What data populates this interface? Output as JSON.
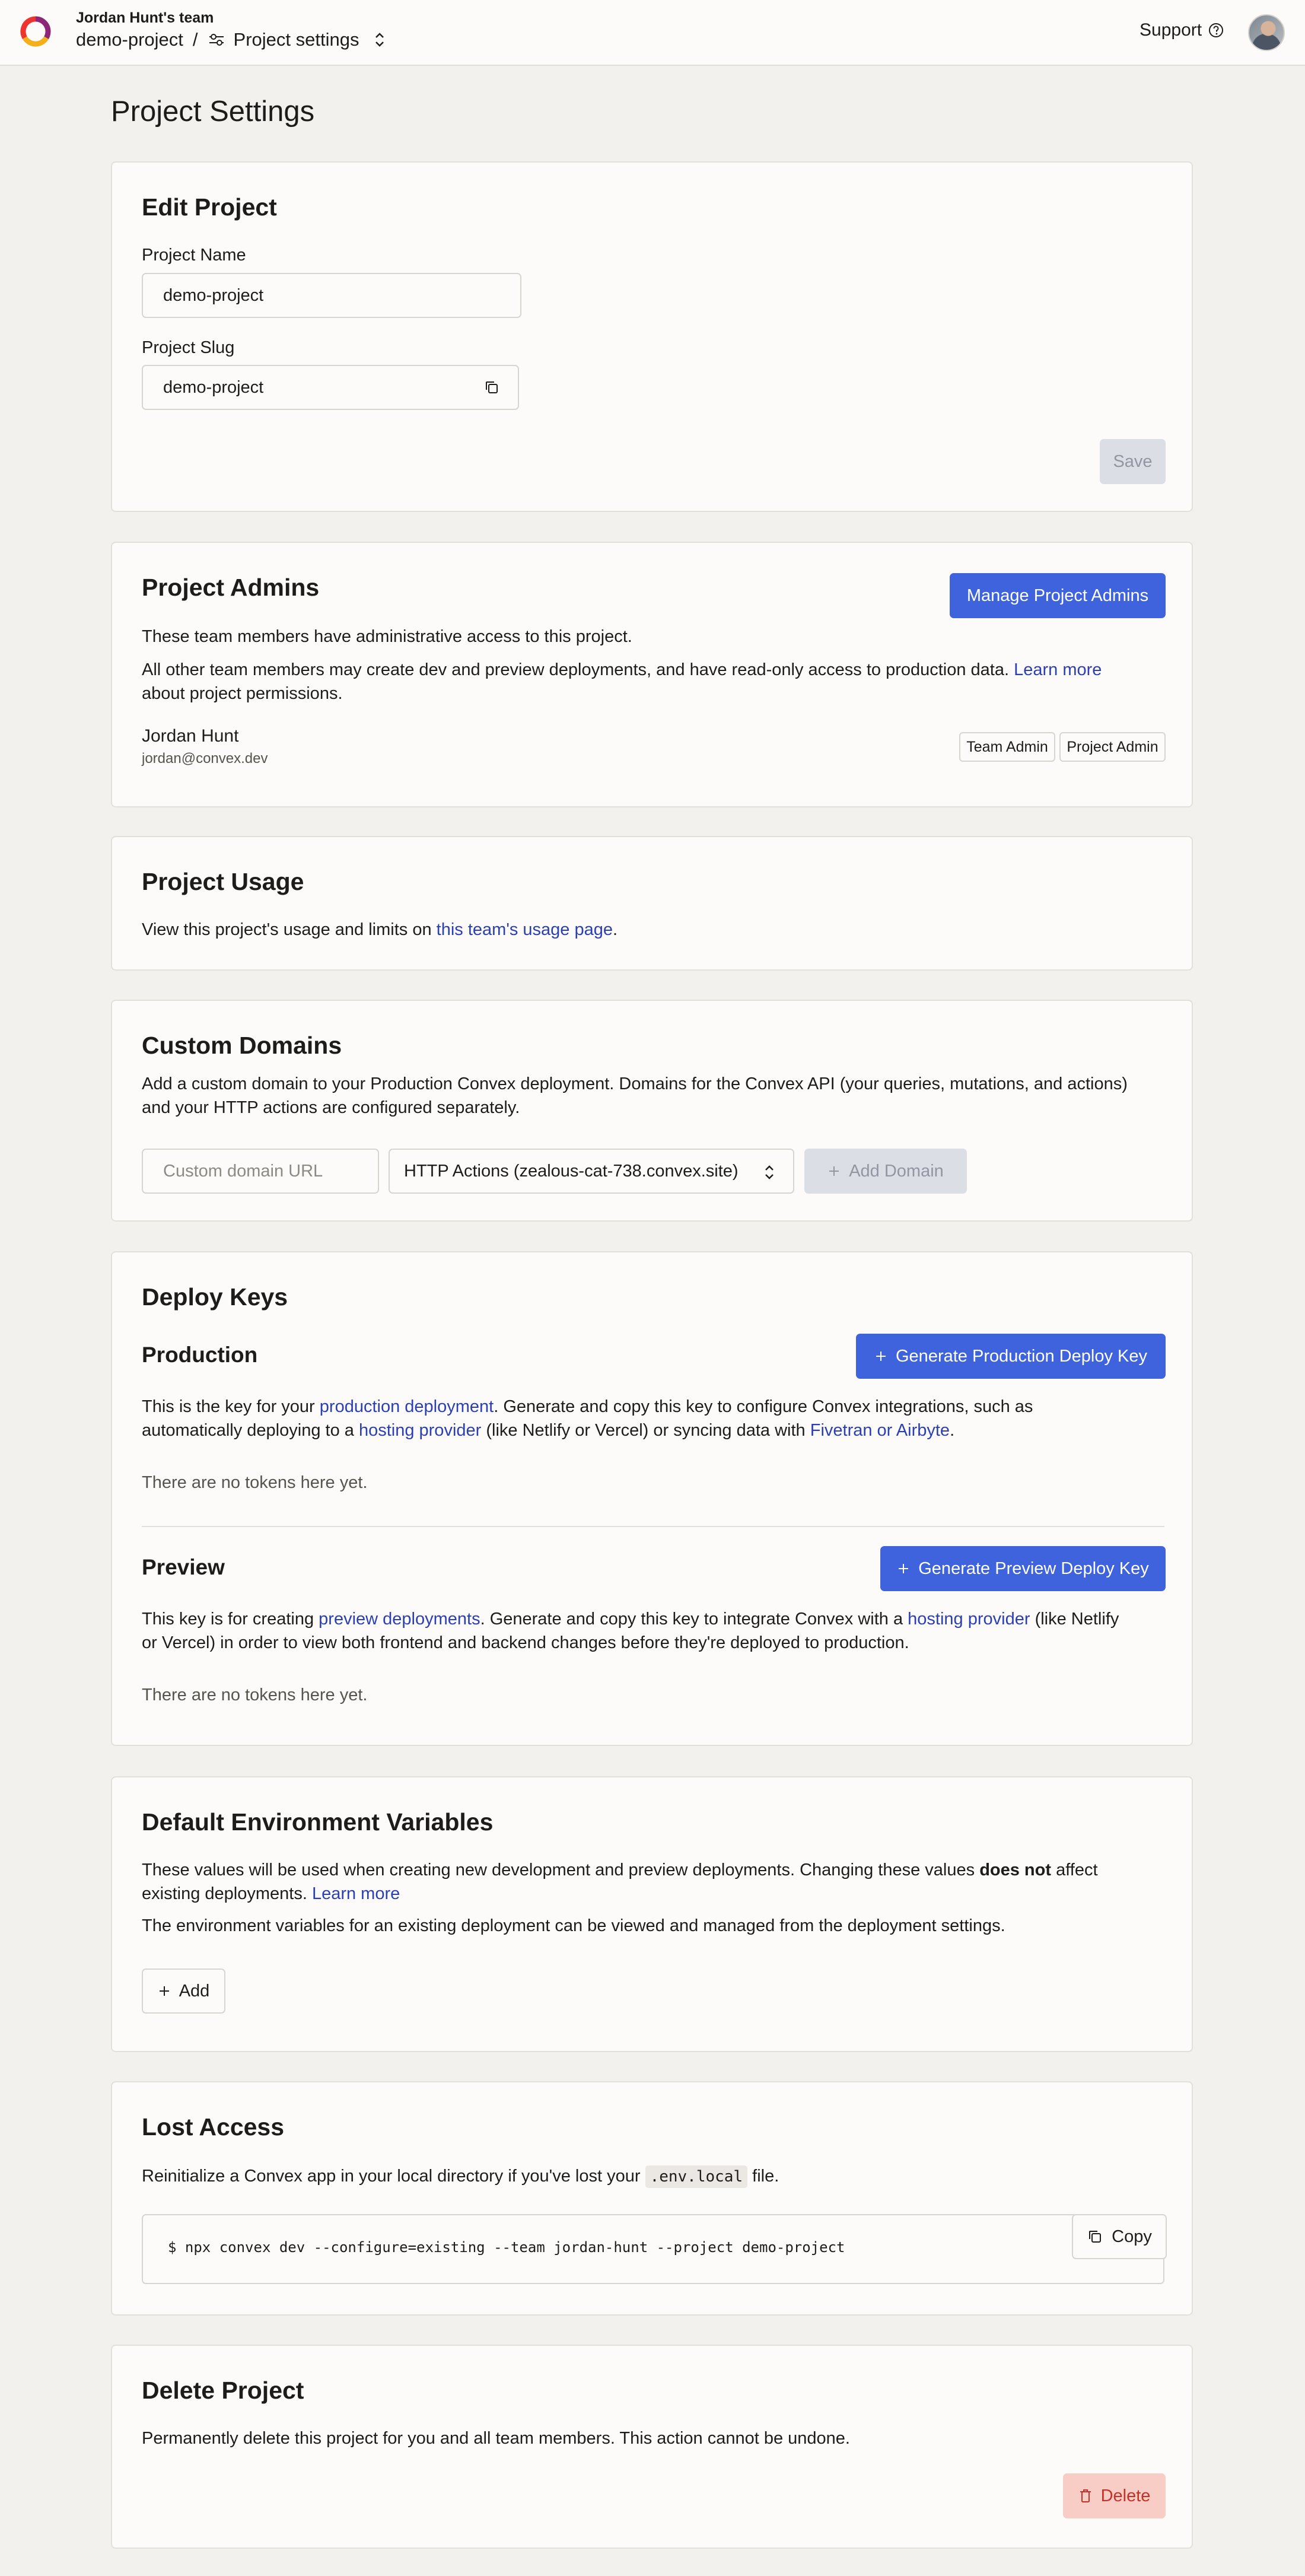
{
  "header": {
    "team_name": "Jordan Hunt's team",
    "project": "demo-project",
    "separator": "/",
    "current_page": "Project settings",
    "support_label": "Support"
  },
  "page": {
    "title": "Project Settings"
  },
  "edit_project": {
    "title": "Edit Project",
    "name_label": "Project Name",
    "name_value": "demo-project",
    "slug_label": "Project Slug",
    "slug_value": "demo-project",
    "save_label": "Save"
  },
  "admins": {
    "title": "Project Admins",
    "manage_label": "Manage Project Admins",
    "desc1": "These team members have administrative access to this project.",
    "desc2_pre": "All other team members may create dev and preview deployments, and have read-only access to production data.",
    "desc2_link": "Learn more",
    "desc2_post": "about project permissions.",
    "member_name": "Jordan Hunt",
    "member_email": "jordan@convex.dev",
    "badges": [
      "Team Admin",
      "Project Admin"
    ]
  },
  "usage": {
    "title": "Project Usage",
    "text_pre": "View this project's usage and limits on",
    "link": "this team's usage page",
    "text_post": "."
  },
  "domains": {
    "title": "Custom Domains",
    "desc_line1": "Add a custom domain to your Production Convex deployment. Domains for the Convex API (your queries, mutations, and actions)",
    "desc_line2": "and your HTTP actions are configured separately.",
    "url_placeholder": "Custom domain URL",
    "select_value": "HTTP Actions (zealous-cat-738.convex.site)",
    "add_label": "Add Domain"
  },
  "deploy_keys": {
    "title": "Deploy Keys",
    "production": {
      "title": "Production",
      "button": "Generate Production Deploy Key",
      "l1_a": "This is the key for your",
      "l1_link": "production deployment",
      "l1_b": ". Generate and copy this key to configure Convex integrations, such as",
      "l2_a": "automatically deploying to a",
      "l2_link1": "hosting provider",
      "l2_b": "(like Netlify or Vercel) or syncing data with",
      "l2_link2": "Fivetran or Airbyte",
      "l2_c": ".",
      "empty": "There are no tokens here yet."
    },
    "preview": {
      "title": "Preview",
      "button": "Generate Preview Deploy Key",
      "l1_a": "This key is for creating",
      "l1_link": "preview deployments",
      "l1_b": ". Generate and copy this key to integrate Convex with a",
      "l1_link2": "hosting provider",
      "l1_c": "(like Netlify",
      "l2": "or Vercel) in order to view both frontend and backend changes before they're deployed to production.",
      "empty": "There are no tokens here yet."
    }
  },
  "env_vars": {
    "title": "Default Environment Variables",
    "l1_a": "These values will be used when creating new development and preview deployments. Changing these values",
    "l1_bold": "does not",
    "l1_b": "affect",
    "l2_a": "existing deployments.",
    "l2_link": "Learn more",
    "l3": "The environment variables for an existing deployment can be viewed and managed from the deployment settings.",
    "add_label": "Add"
  },
  "lost_access": {
    "title": "Lost Access",
    "text_pre": "Reinitialize a Convex app in your local directory if you've lost your",
    "code": ".env.local",
    "text_post": "file.",
    "command": "$ npx convex dev --configure=existing --team jordan-hunt --project demo-project",
    "copy_label": "Copy"
  },
  "delete": {
    "title": "Delete Project",
    "desc": "Permanently delete this project for you and all team members. This action cannot be undone.",
    "button": "Delete"
  },
  "colors": {
    "primary": "#3e63dd",
    "link": "#2b3fb4",
    "danger_bg": "#f7cdc5",
    "danger_text": "#c53127",
    "page_bg": "#f3f1ee",
    "card_bg": "#fcfbf9"
  }
}
